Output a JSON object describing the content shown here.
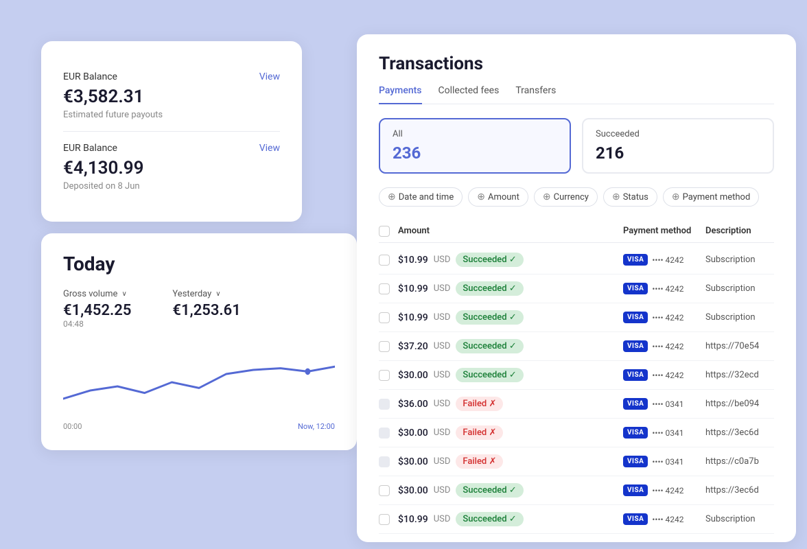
{
  "balance_cards": [
    {
      "label": "EUR Balance",
      "view_text": "View",
      "amount": "€3,582.31",
      "sub": "Estimated future payouts"
    },
    {
      "label": "EUR Balance",
      "view_text": "View",
      "amount": "€4,130.99",
      "sub": "Deposited on 8 Jun"
    }
  ],
  "today": {
    "title": "Today",
    "gross_volume_label": "Gross volume",
    "gross_volume_value": "€1,452.25",
    "gross_volume_time": "04:48",
    "yesterday_label": "Yesterday",
    "yesterday_value": "€1,253.61",
    "chart_start": "00:00",
    "chart_end": "Now, 12:00"
  },
  "transactions": {
    "title": "Transactions",
    "tabs": [
      {
        "label": "Payments",
        "active": true
      },
      {
        "label": "Collected fees",
        "active": false
      },
      {
        "label": "Transfers",
        "active": false
      }
    ],
    "filters": [
      {
        "label": "Date and time"
      },
      {
        "label": "Amount"
      },
      {
        "label": "Currency"
      },
      {
        "label": "Status"
      },
      {
        "label": "Payment method"
      }
    ],
    "summary": [
      {
        "label": "All",
        "value": "236",
        "active": true
      },
      {
        "label": "Succeeded",
        "value": "216",
        "active": false
      }
    ],
    "table_headers": [
      "",
      "Amount",
      "Payment method",
      "Description"
    ],
    "rows": [
      {
        "amount": "$10.99",
        "currency": "USD",
        "status": "Succeeded",
        "card_last4": "4242",
        "description": "Subscription"
      },
      {
        "amount": "$10.99",
        "currency": "USD",
        "status": "Succeeded",
        "card_last4": "4242",
        "description": "Subscription"
      },
      {
        "amount": "$10.99",
        "currency": "USD",
        "status": "Succeeded",
        "card_last4": "4242",
        "description": "Subscription"
      },
      {
        "amount": "$37.20",
        "currency": "USD",
        "status": "Succeeded",
        "card_last4": "4242",
        "description": "https://70e54"
      },
      {
        "amount": "$30.00",
        "currency": "USD",
        "status": "Succeeded",
        "card_last4": "4242",
        "description": "https://32ecd"
      },
      {
        "amount": "$36.00",
        "currency": "USD",
        "status": "Failed",
        "card_last4": "0341",
        "description": "https://be094"
      },
      {
        "amount": "$30.00",
        "currency": "USD",
        "status": "Failed",
        "card_last4": "0341",
        "description": "https://3ec6d"
      },
      {
        "amount": "$30.00",
        "currency": "USD",
        "status": "Failed",
        "card_last4": "0341",
        "description": "https://c0a7b"
      },
      {
        "amount": "$30.00",
        "currency": "USD",
        "status": "Succeeded",
        "card_last4": "4242",
        "description": "https://3ec6d"
      },
      {
        "amount": "$10.99",
        "currency": "USD",
        "status": "Succeeded",
        "card_last4": "4242",
        "description": "Subscription"
      }
    ]
  }
}
